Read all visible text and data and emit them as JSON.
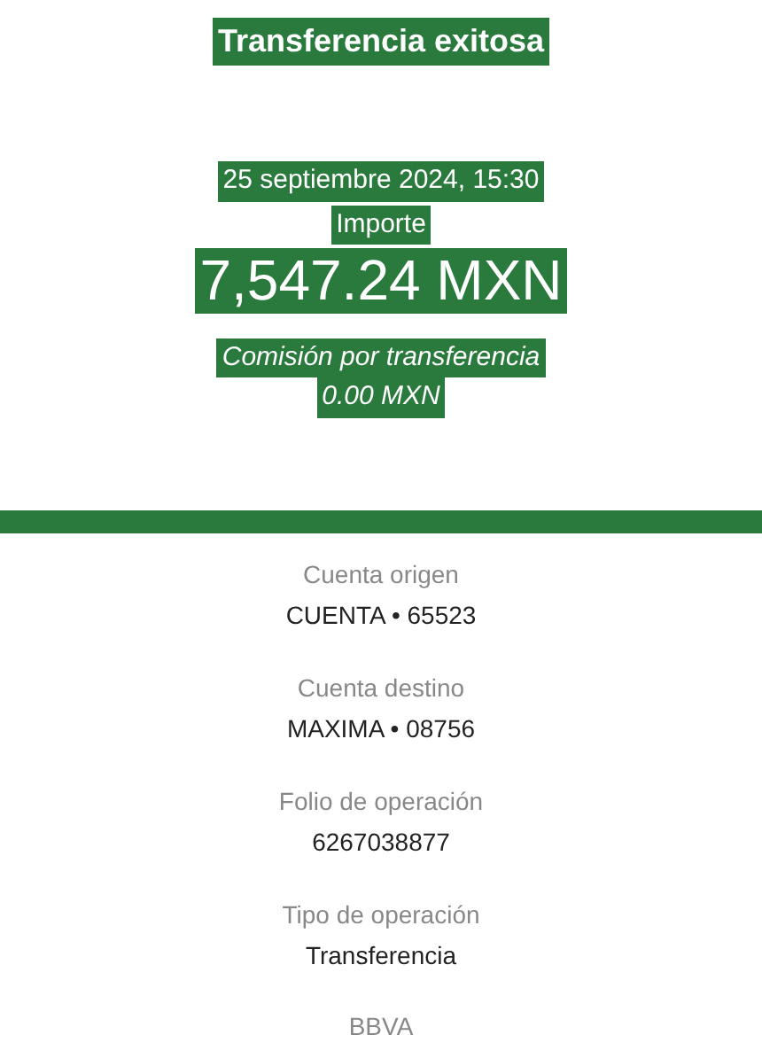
{
  "header": {
    "title": "Transferencia exitosa",
    "date": "25 septiembre 2024, 15:30",
    "amount_label": "Importe",
    "amount": "7,547.24 MXN",
    "fee_label": "Comisión por transferencia",
    "fee": "0.00 MXN"
  },
  "details": [
    {
      "label": "Cuenta origen",
      "value": "CUENTA • 65523"
    },
    {
      "label": "Cuenta destino",
      "value": "MAXIMA • 08756"
    },
    {
      "label": "Folio de operación",
      "value": "6267038877"
    },
    {
      "label": "Tipo de operación",
      "value": "Transferencia"
    }
  ],
  "footer": "BBVA"
}
